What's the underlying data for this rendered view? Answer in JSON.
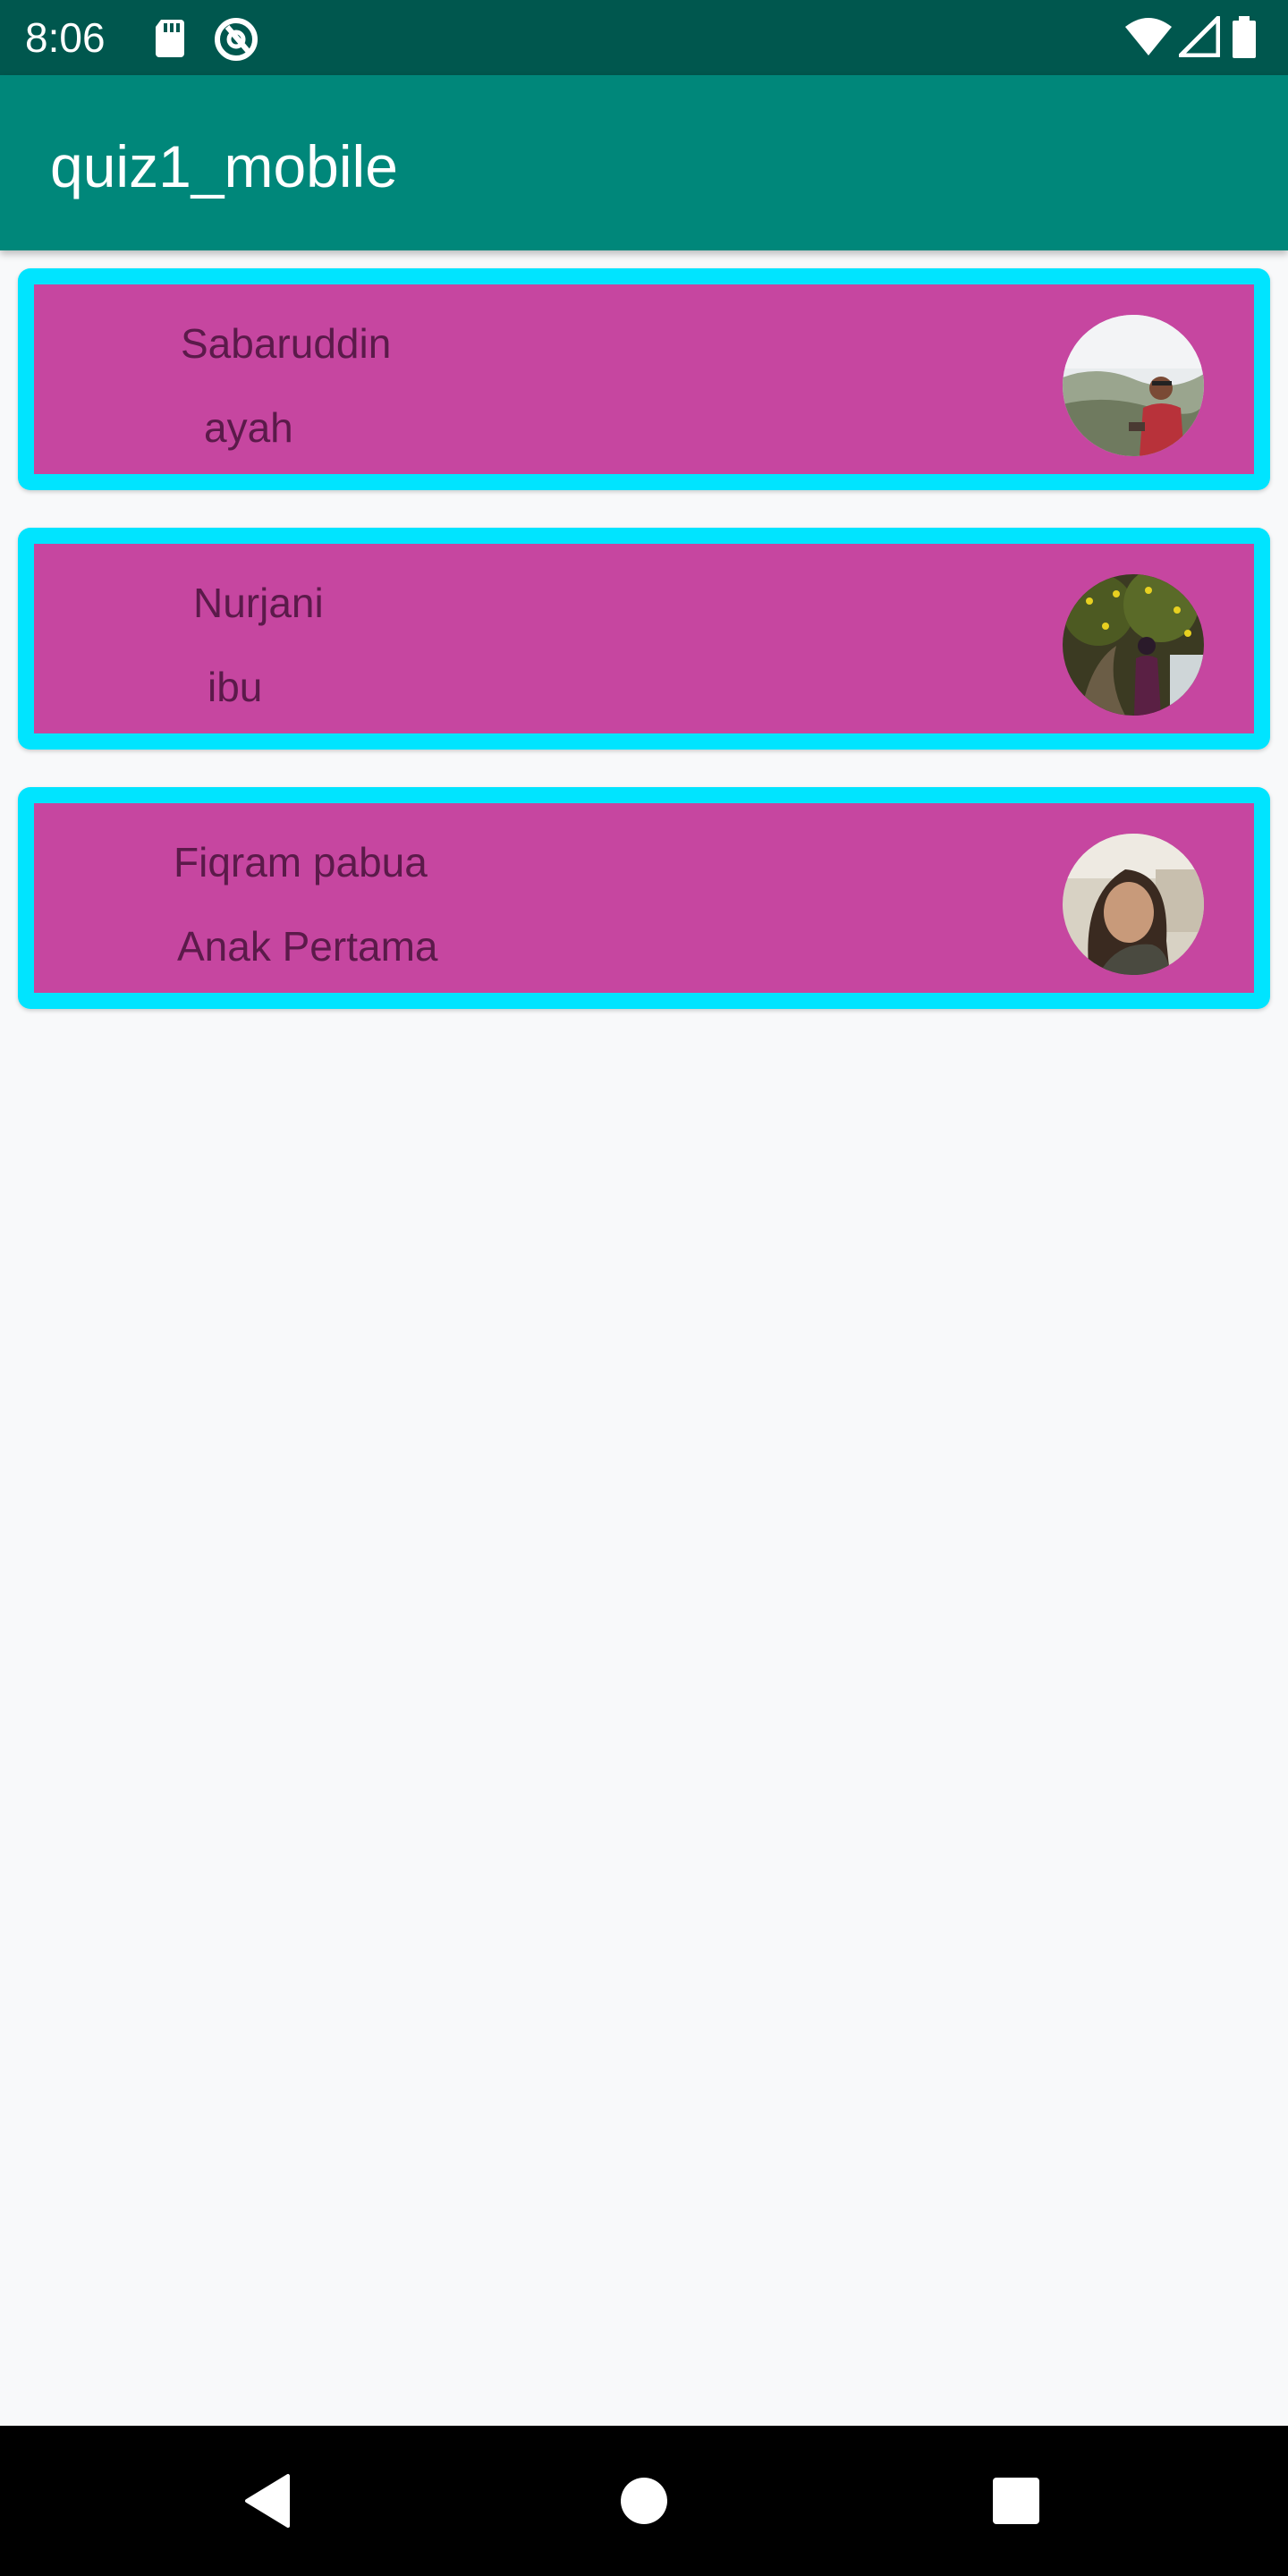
{
  "status_bar": {
    "time": "8:06",
    "icons": [
      "sd-card-icon",
      "sync-icon",
      "wifi-icon",
      "signal-icon",
      "battery-icon"
    ]
  },
  "app_bar": {
    "title": "quiz1_mobile"
  },
  "colors": {
    "status_bar": "#00574e",
    "app_bar": "#00877a",
    "card_border": "#00e4ff",
    "card_fill": "#c646a0",
    "card_text": "#5b1a4a"
  },
  "contacts": [
    {
      "name": "Sabaruddin",
      "role": "ayah",
      "avatar": "photo-man-landscape"
    },
    {
      "name": "Nurjani",
      "role": "ibu",
      "avatar": "photo-woman-tree"
    },
    {
      "name": "Fiqram pabua",
      "role": "Anak Pertama",
      "avatar": "photo-person-portrait"
    }
  ],
  "nav_bar": {
    "buttons": [
      "back-icon",
      "home-icon",
      "recents-icon"
    ]
  }
}
